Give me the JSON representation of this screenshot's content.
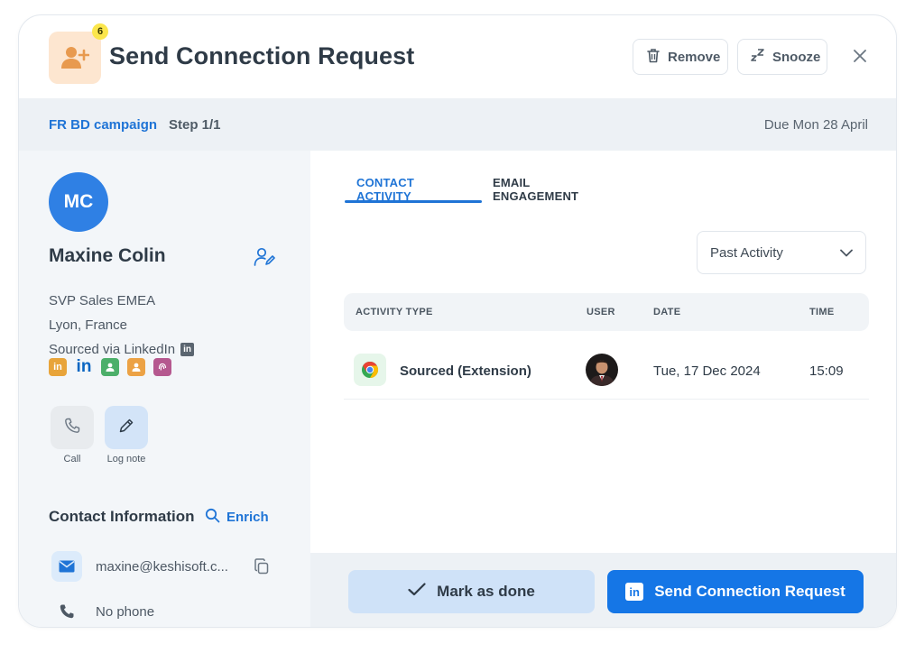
{
  "header": {
    "title": "Send Connection Request",
    "task_count": "6",
    "remove_label": "Remove",
    "snooze_label": "Snooze",
    "icons": {
      "task": "add-user-icon",
      "remove": "trash-icon",
      "snooze": "snooze-icon",
      "close": "close-icon"
    }
  },
  "campaign": {
    "name": "FR BD campaign",
    "step": "Step 1/1",
    "due": "Due Mon 28 April"
  },
  "contact": {
    "initials": "MC",
    "name": "Maxine Colin",
    "title": "SVP Sales EMEA",
    "location": "Lyon, France",
    "source": "Sourced via LinkedIn",
    "social_icons": [
      "linkedin-icon",
      "linkedin-icon",
      "contact-icon",
      "contact-icon",
      "fingerprint-icon"
    ],
    "actions": [
      {
        "label": "Call",
        "icon": "phone-icon"
      },
      {
        "label": "Log note",
        "icon": "pencil-icon"
      }
    ],
    "info_title": "Contact Information",
    "enrich_label": "Enrich",
    "email": "maxine@keshisoft.c...",
    "phone": "No phone"
  },
  "activity": {
    "tabs": [
      {
        "label": "CONTACT ACTIVITY",
        "active": true
      },
      {
        "label": "EMAIL ENGAGEMENT",
        "active": false
      }
    ],
    "filter": "Past Activity",
    "columns": [
      "ACTIVITY TYPE",
      "USER",
      "DATE",
      "TIME"
    ],
    "rows": [
      {
        "type": "Sourced (Extension)",
        "icon": "chrome-icon",
        "date": "Tue, 17 Dec 2024",
        "time": "15:09"
      }
    ]
  },
  "footer": {
    "done_label": "Mark as done",
    "send_label": "Send Connection Request"
  },
  "colors": {
    "accent": "#1f74d6",
    "primary_button": "#1576e6",
    "secondary_button": "#cfe2f8",
    "panel_bg": "#f3f6f9"
  }
}
